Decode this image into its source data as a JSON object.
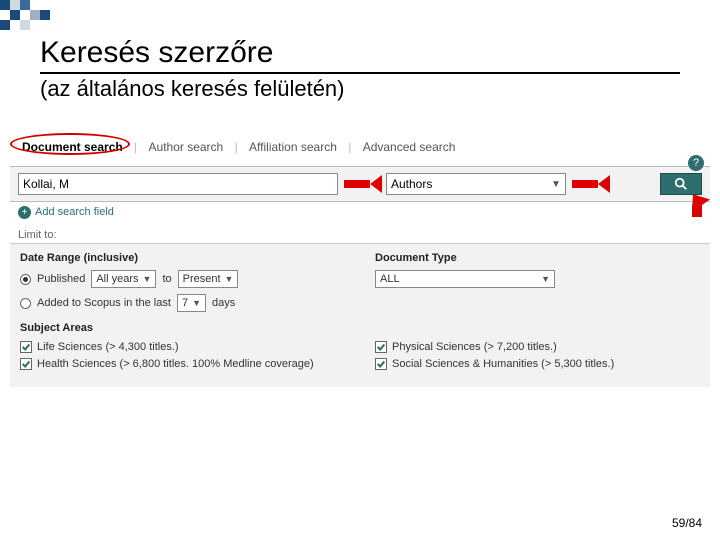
{
  "slide": {
    "title": "Keresés szerzőre",
    "subtitle": "(az általános keresés felületén)"
  },
  "tabs": {
    "items": [
      "Document search",
      "Author search",
      "Affiliation search",
      "Advanced search"
    ],
    "active_index": 0
  },
  "search": {
    "term_value": "Kollai, M",
    "field_value": "Authors",
    "add_field_label": "Add search field",
    "help_badge": "?"
  },
  "limit": {
    "label": "Limit to:",
    "date_range_header": "Date Range (inclusive)",
    "published_label": "Published",
    "published_from": "All years",
    "to_label": "to",
    "published_to": "Present",
    "added_label": "Added to Scopus in the last",
    "added_days_value": "7",
    "days_label": "days",
    "doc_type_header": "Document Type",
    "doc_type_value": "ALL"
  },
  "subject": {
    "header": "Subject Areas",
    "left": [
      "Life Sciences (> 4,300 titles.)",
      "Health Sciences (> 6,800 titles. 100% Medline coverage)"
    ],
    "right": [
      "Physical Sciences (> 7,200 titles.)",
      "Social Sciences & Humanities (> 5,300 titles.)"
    ]
  },
  "pager": {
    "text": "59/84"
  }
}
